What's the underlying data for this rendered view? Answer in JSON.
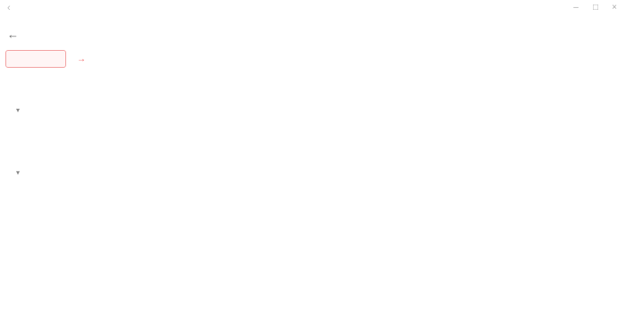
{
  "topbar": {
    "url": "",
    "controls": [
      "minimize-icon",
      "maximize-icon",
      "close-icon"
    ]
  },
  "header": {
    "back_icon": "arrow-left-icon",
    "title": ""
  },
  "actions": {
    "primary_label": "",
    "arrow_glyph": "→",
    "secondary_label": ""
  },
  "sub_note": "",
  "side_panel": {
    "label": "",
    "value": ""
  },
  "section": {
    "title": ""
  },
  "groups": [
    {
      "name": "",
      "items": [
        {
          "lines": [
            "",
            ""
          ],
          "link": ""
        }
      ]
    },
    {
      "name": "",
      "items": [
        {
          "link": "",
          "text": ""
        },
        {
          "link": "",
          "text": ""
        },
        {
          "link": "",
          "text": ""
        },
        {
          "link": "",
          "text": ""
        },
        {
          "link": "",
          "text": ""
        }
      ]
    }
  ],
  "colors": {
    "accent_red": "#f06464",
    "link_green": "#8bc34a"
  }
}
